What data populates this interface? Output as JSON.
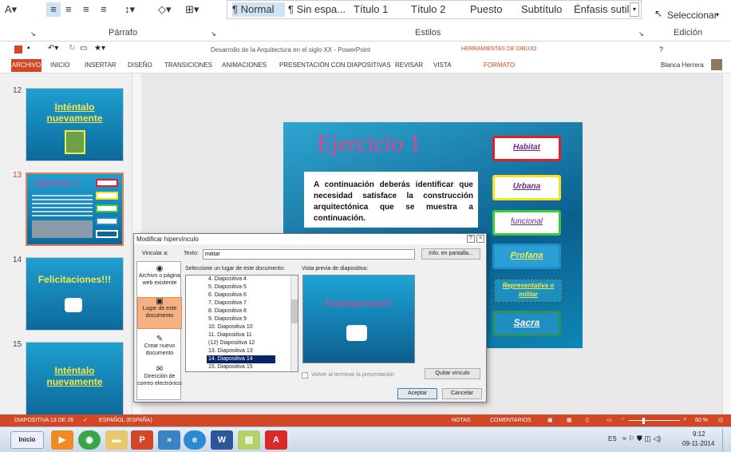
{
  "ribbon_top": {
    "styles": [
      "¶ Normal",
      "¶ Sin espa...",
      "Título 1",
      "Título 2",
      "Puesto",
      "Subtítulo",
      "Énfasis sutil"
    ],
    "select_label": "Seleccionar",
    "group_parrafo": "Párrafo",
    "group_estilos": "Estilos",
    "group_edicion": "Edición"
  },
  "ppt": {
    "window_title": "Desarrollo de la Arquitectura en el siglo XX - PowerPoint",
    "tools_header": "HERRAMIENTAS DE DIBUJO",
    "user": "Blanca Herrera",
    "help": "?",
    "menu": {
      "archivo": "ARCHIVO",
      "inicio": "INICIO",
      "insertar": "INSERTAR",
      "diseno": "DISEÑO",
      "transiciones": "TRANSICIONES",
      "animaciones": "ANIMACIONES",
      "presentacion": "PRESENTACIÓN CON DIAPOSITIVAS",
      "revisar": "REVISAR",
      "vista": "VISTA",
      "formato": "FORMATO"
    }
  },
  "slides": [
    {
      "num": "12",
      "title": "Inténtalo nuevamente"
    },
    {
      "num": "13",
      "title": "Ejercicio 1"
    },
    {
      "num": "14",
      "title": "Felicitaciones!!!"
    },
    {
      "num": "15",
      "title": "Inténtalo nuevamente"
    }
  ],
  "main_slide": {
    "title": "Ejercicio 1",
    "body": "A continuación deberás identificar que necesidad satisface la construcción arquitectónica que se muestra a continuación.",
    "boxes": [
      {
        "label": "Habitat",
        "color": "#e21f26"
      },
      {
        "label": "Urbana",
        "color": "#f7e11c"
      },
      {
        "label": "funcional",
        "color": "#3ec93a"
      },
      {
        "label": "Profana",
        "color": "#1f8fcf"
      },
      {
        "label": "Representativa o militar",
        "color": "#ffffff"
      },
      {
        "label": "Sacra",
        "color": "#2f8f5e"
      }
    ]
  },
  "dialog": {
    "title": "Modificar hipervínculo",
    "vincular_a": "Vincular a:",
    "texto_label": "Texto:",
    "texto_value": "militar",
    "info_button": "Info. en pantalla...",
    "list_label": "Seleccione un lugar de este documento:",
    "preview_label": "Vista previa de diapositiva:",
    "preview_title": "Felicitaciones!!!",
    "options": [
      {
        "label": "Archivo o página web existente"
      },
      {
        "label": "Lugar de este documento"
      },
      {
        "label": "Crear nuevo documento"
      },
      {
        "label": "Dirección de correo electrónico"
      }
    ],
    "list_items": [
      "4. Diapositiva 4",
      "5. Diapositiva 5",
      "6. Diapositiva 6",
      "7. Diapositiva 7",
      "8. Diapositiva 8",
      "9. Diapositiva 9",
      "10. Diapositiva 10",
      "11. Diapositiva 11",
      "(12) Diapositiva 12",
      "13. Diapositiva 13",
      "14. Diapositiva 14",
      "15. Diapositiva 15"
    ],
    "selected_item": "14. Diapositiva 14",
    "volver_checkbox": "Volver al terminar la presentación",
    "quitar_button": "Quitar vínculo",
    "aceptar_button": "Aceptar",
    "cancelar_button": "Cancelar"
  },
  "status": {
    "slide": "DIAPOSITIVA 13 DE 26",
    "language": "ESPAÑOL (ESPAÑA)",
    "notas": "NOTAS",
    "comentarios": "COMENTARIOS",
    "zoom": "60 %"
  },
  "taskbar": {
    "start": "Inicio",
    "lang": "ES",
    "time": "9:12",
    "date": "09-11-2014"
  }
}
